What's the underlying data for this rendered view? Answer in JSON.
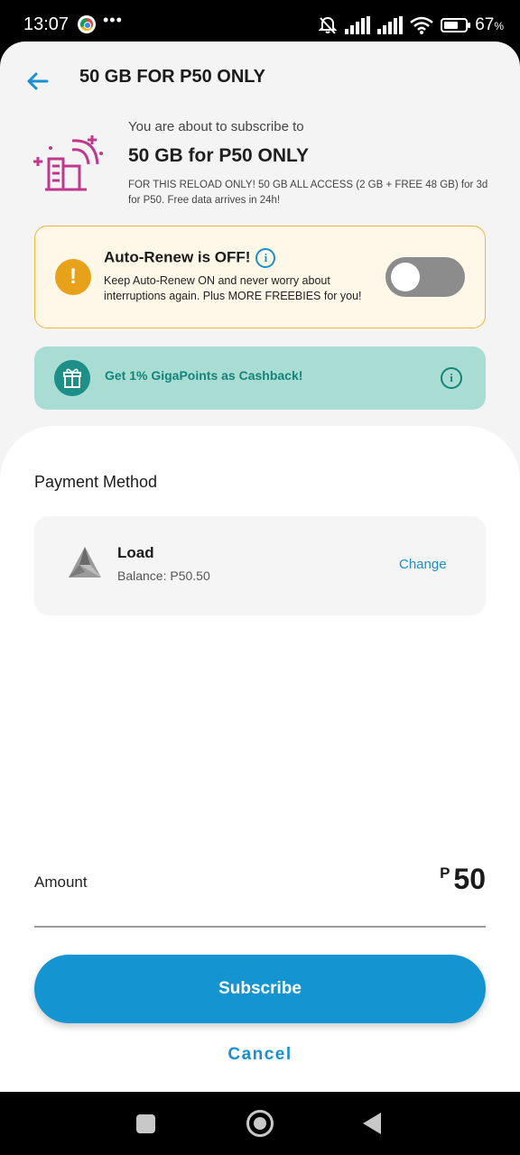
{
  "status_bar": {
    "time": "13:07",
    "notification_dots": "•••",
    "battery_percent": "67",
    "battery_symbol": "%",
    "battery_level": 0.67,
    "icons": [
      "chrome-icon",
      "bell-off-icon",
      "signal-icon",
      "signal-icon",
      "wifi-icon",
      "battery-icon"
    ]
  },
  "header": {
    "title": "50 GB FOR P50 ONLY",
    "back_icon": "arrow-left-icon"
  },
  "promo": {
    "subtitle": "You are about to subscribe to",
    "title": "50 GB for P50 ONLY",
    "description": "FOR THIS RELOAD ONLY! 50 GB ALL ACCESS (2 GB + FREE 48 GB) for 3d for P50. Free data arrives in 24h!",
    "icon": "city-signal-icon"
  },
  "auto_renew": {
    "title": "Auto-Renew is OFF!",
    "info_glyph": "i",
    "description": "Keep Auto-Renew ON and never worry about interruptions again. Plus MORE FREEBIES for you!",
    "warning_glyph": "!",
    "enabled": false
  },
  "cashback": {
    "text": "Get 1% GigaPoints as Cashback!",
    "info_glyph": "i",
    "icon": "gift-icon"
  },
  "payment": {
    "section_label": "Payment Method",
    "method_name": "Load",
    "balance": "Balance: P50.50",
    "change_label": "Change"
  },
  "amount": {
    "label": "Amount",
    "currency": "P",
    "value": "50"
  },
  "actions": {
    "subscribe_label": "Subscribe",
    "cancel_label": "Cancel"
  },
  "colors": {
    "primary": "#1495d1",
    "warning": "#e7a21a",
    "cashback_bg": "#a9ddd3",
    "cashback_text": "#14847a",
    "promo_icon": "#c2378e"
  }
}
